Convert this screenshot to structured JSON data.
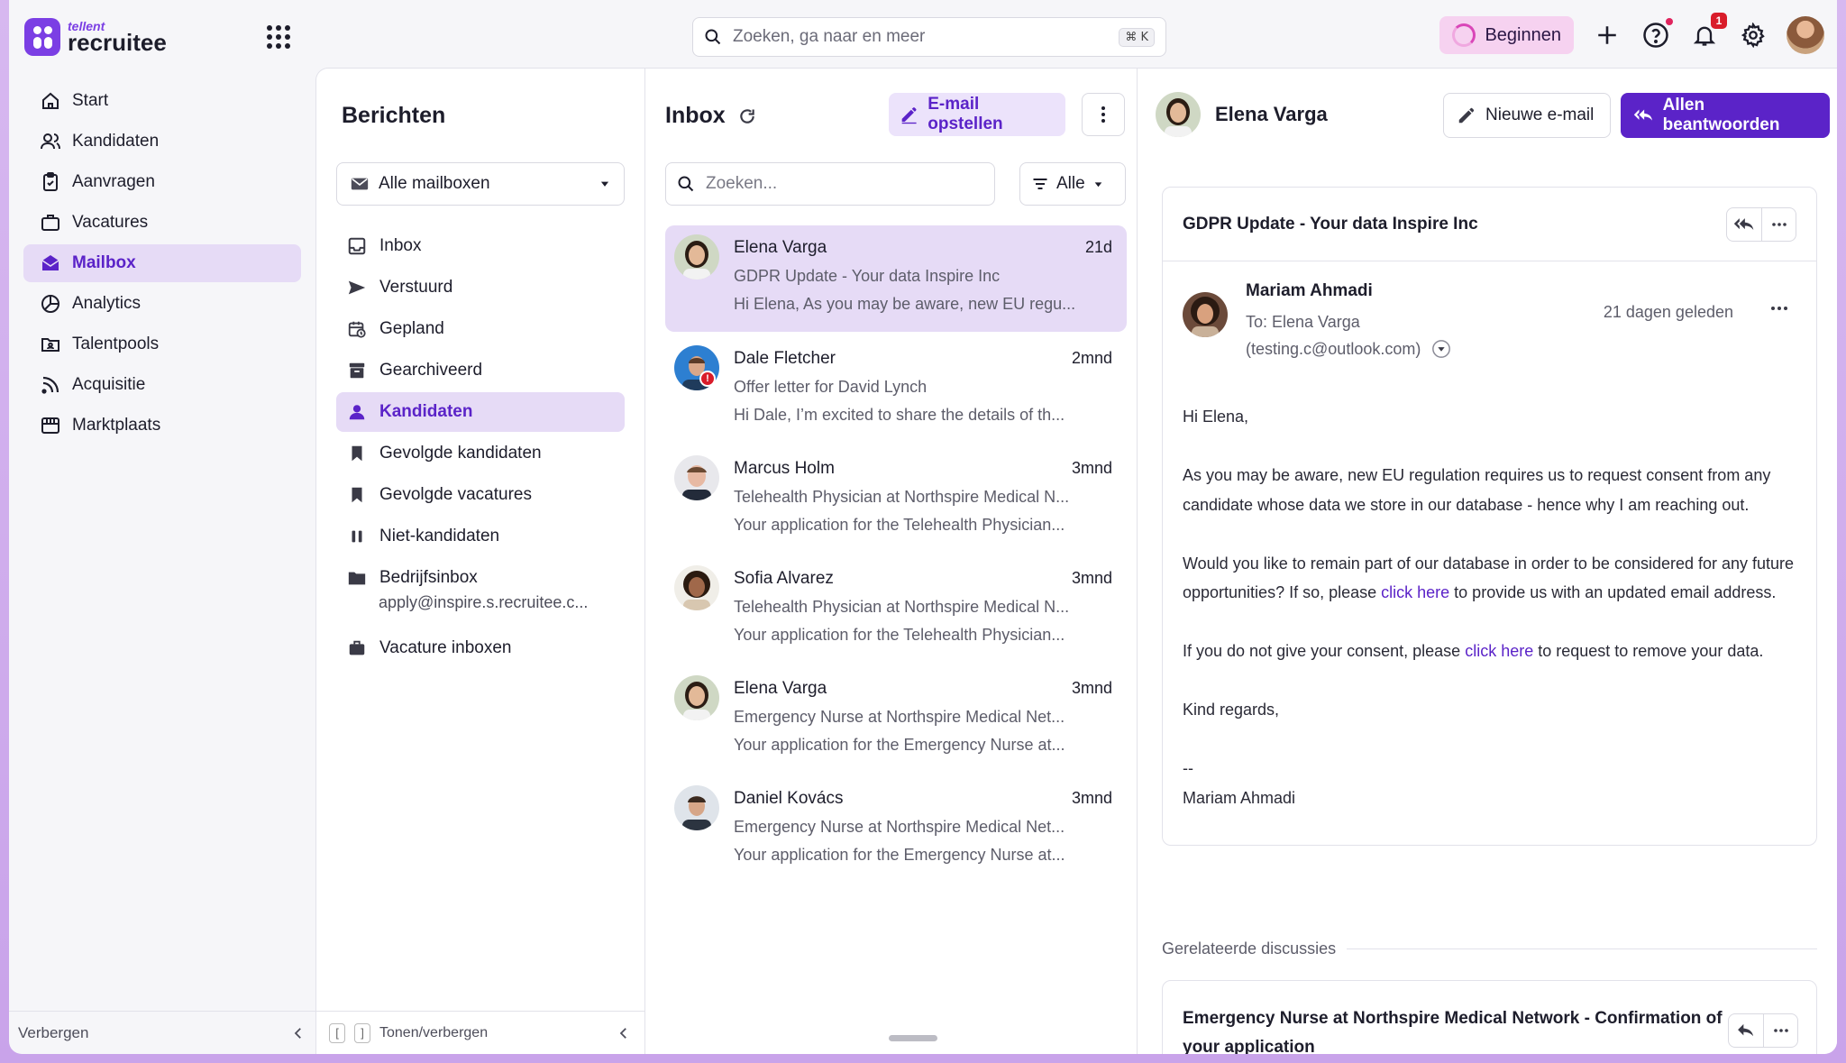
{
  "brand": {
    "small": "tellent",
    "big": "recruitee",
    "accent": "#5b23c8"
  },
  "top": {
    "search_placeholder": "Zoeken, ga naar en meer",
    "shortcut": "⌘ K",
    "begin_label": "Beginnen",
    "notifications_count": "1"
  },
  "nav": {
    "items": [
      {
        "label": "Start",
        "icon": "home-icon"
      },
      {
        "label": "Kandidaten",
        "icon": "users-icon"
      },
      {
        "label": "Aanvragen",
        "icon": "clipboard-icon"
      },
      {
        "label": "Vacatures",
        "icon": "briefcase-icon"
      },
      {
        "label": "Mailbox",
        "icon": "mailbox-icon",
        "active": true
      },
      {
        "label": "Analytics",
        "icon": "chart-pie-icon"
      },
      {
        "label": "Talentpools",
        "icon": "folder-user-icon"
      },
      {
        "label": "Acquisitie",
        "icon": "rss-icon"
      },
      {
        "label": "Marktplaats",
        "icon": "store-icon"
      }
    ],
    "footer_label": "Verbergen"
  },
  "folders": {
    "title": "Berichten",
    "mailbox_select": "Alle mailboxen",
    "items": [
      {
        "label": "Inbox",
        "icon": "inbox-icon"
      },
      {
        "label": "Verstuurd",
        "icon": "send-icon"
      },
      {
        "label": "Gepland",
        "icon": "calendar-clock-icon"
      },
      {
        "label": "Gearchiveerd",
        "icon": "archive-icon"
      },
      {
        "label": "Kandidaten",
        "icon": "person-icon",
        "active": true
      },
      {
        "label": "Gevolgde kandidaten",
        "icon": "bookmark-icon"
      },
      {
        "label": "Gevolgde vacatures",
        "icon": "bookmark-icon"
      },
      {
        "label": "Niet-kandidaten",
        "icon": "pause-icon"
      },
      {
        "label": "Bedrijfsinbox",
        "icon": "folder-icon",
        "sub": "apply@inspire.s.recruitee.c..."
      },
      {
        "label": "Vacature inboxen",
        "icon": "briefcase-icon"
      }
    ],
    "footer_label": "Tonen/verbergen"
  },
  "inbox": {
    "title": "Inbox",
    "compose_label": "E-mail opstellen",
    "search_placeholder": "Zoeken...",
    "filter_label": "Alle",
    "messages": [
      {
        "from": "Elena Varga",
        "time": "21d",
        "subject": "GDPR Update - Your data Inspire Inc",
        "snippet": "Hi Elena, As you may be aware, new EU regu...",
        "active": true
      },
      {
        "from": "Dale Fletcher",
        "time": "2mnd",
        "subject": "Offer letter for David Lynch",
        "snippet": "Hi Dale, I’m excited to share the details of th..."
      },
      {
        "from": "Marcus Holm",
        "time": "3mnd",
        "subject": "Telehealth Physician at Northspire Medical N...",
        "snippet": "Your application for the Telehealth Physician..."
      },
      {
        "from": "Sofia Alvarez",
        "time": "3mnd",
        "subject": "Telehealth Physician at Northspire Medical N...",
        "snippet": "Your application for the Telehealth Physician..."
      },
      {
        "from": "Elena Varga",
        "time": "3mnd",
        "subject": "Emergency Nurse at Northspire Medical Net...",
        "snippet": "Your application for the Emergency Nurse at..."
      },
      {
        "from": "Daniel Kovács",
        "time": "3mnd",
        "subject": "Emergency Nurse at Northspire Medical Net...",
        "snippet": "Your application for the Emergency Nurse at..."
      }
    ]
  },
  "reader": {
    "contact_name": "Elena Varga",
    "new_mail_label": "Nieuwe e-mail",
    "reply_all_label": "Allen beantwoorden",
    "thread_subject": "GDPR Update - Your data Inspire Inc",
    "sender_name": "Mariam Ahmadi",
    "to_line": "To: Elena Varga",
    "to_email": "(testing.c@outlook.com)",
    "when": "21 dagen geleden",
    "body": {
      "greeting": "Hi Elena,",
      "p1": "As you may be aware, new EU regulation requires us to request consent from any candidate whose data we store in our database - hence why I am reaching out.",
      "p2_before": "Would you like to remain part of our database in order to be considered for any future opportunities? If so, please ",
      "p2_link": "click here",
      "p2_after": " to provide us with an updated email address.",
      "p3_before": "If you do not give your consent, please ",
      "p3_link": "click here",
      "p3_after": " to request to remove your data.",
      "closing": "Kind regards,",
      "sig_dash": "--",
      "sig_name": "Mariam Ahmadi"
    },
    "related_label": "Gerelateerde discussies",
    "related_subject": "Emergency Nurse at Northspire Medical Network - Confirmation of your application"
  }
}
